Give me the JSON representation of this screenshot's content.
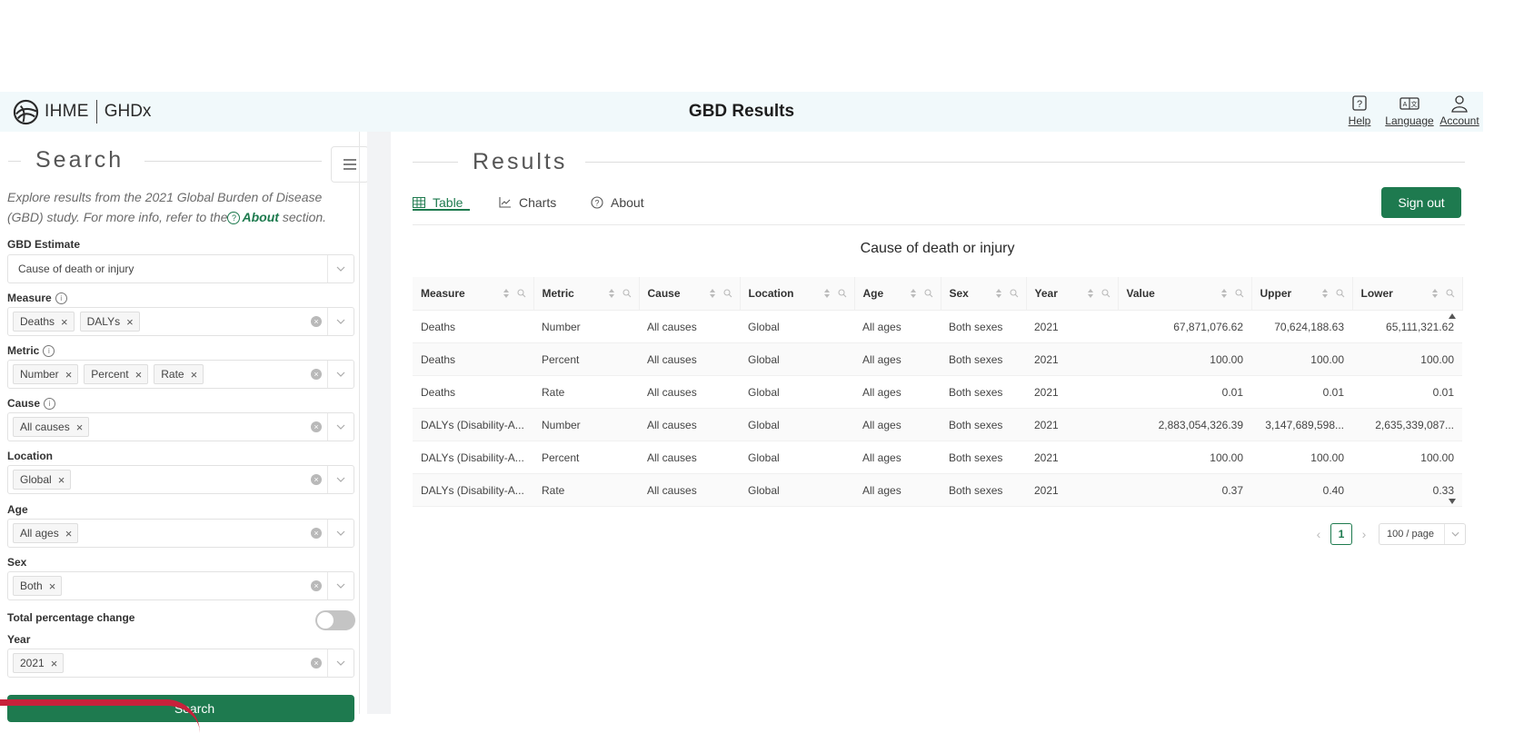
{
  "header": {
    "logo_left": "IHME",
    "logo_right": "GHDx",
    "title": "GBD Results",
    "icons": [
      {
        "label": "Help",
        "icon": "help-icon"
      },
      {
        "label": "Language",
        "icon": "language-icon"
      },
      {
        "label": "Account",
        "icon": "account-icon"
      }
    ]
  },
  "search": {
    "heading": "Search",
    "intro_text": "Explore results from the 2021 Global Burden of Disease (GBD) study. For more info, refer to the",
    "intro_link": "About",
    "intro_suffix": "section.",
    "gbd_estimate_label": "GBD Estimate",
    "gbd_estimate_value": "Cause of death or injury",
    "measure_label": "Measure",
    "measure_tags": [
      "Deaths",
      "DALYs"
    ],
    "metric_label": "Metric",
    "metric_tags": [
      "Number",
      "Percent",
      "Rate"
    ],
    "cause_label": "Cause",
    "cause_tags": [
      "All causes"
    ],
    "location_label": "Location",
    "location_tags": [
      "Global"
    ],
    "age_label": "Age",
    "age_tags": [
      "All ages"
    ],
    "sex_label": "Sex",
    "sex_tags": [
      "Both"
    ],
    "toggle_label": "Total percentage change",
    "year_label": "Year",
    "year_tags": [
      "2021"
    ],
    "search_button": "Search"
  },
  "results": {
    "heading": "Results",
    "tabs": [
      {
        "label": "Table",
        "icon": "table-icon"
      },
      {
        "label": "Charts",
        "icon": "chart-icon"
      },
      {
        "label": "About",
        "icon": "question-icon"
      }
    ],
    "sign_out": "Sign out",
    "table_title": "Cause of death or injury",
    "columns": [
      "Measure",
      "Metric",
      "Cause",
      "Location",
      "Age",
      "Sex",
      "Year",
      "Value",
      "Upper",
      "Lower"
    ],
    "rows": [
      [
        "Deaths",
        "Number",
        "All causes",
        "Global",
        "All ages",
        "Both sexes",
        "2021",
        "67,871,076.62",
        "70,624,188.63",
        "65,111,321.62"
      ],
      [
        "Deaths",
        "Percent",
        "All causes",
        "Global",
        "All ages",
        "Both sexes",
        "2021",
        "100.00",
        "100.00",
        "100.00"
      ],
      [
        "Deaths",
        "Rate",
        "All causes",
        "Global",
        "All ages",
        "Both sexes",
        "2021",
        "0.01",
        "0.01",
        "0.01"
      ],
      [
        "DALYs (Disability-A...",
        "Number",
        "All causes",
        "Global",
        "All ages",
        "Both sexes",
        "2021",
        "2,883,054,326.39",
        "3,147,689,598...",
        "2,635,339,087..."
      ],
      [
        "DALYs (Disability-A...",
        "Percent",
        "All causes",
        "Global",
        "All ages",
        "Both sexes",
        "2021",
        "100.00",
        "100.00",
        "100.00"
      ],
      [
        "DALYs (Disability-A...",
        "Rate",
        "All causes",
        "Global",
        "All ages",
        "Both sexes",
        "2021",
        "0.37",
        "0.40",
        "0.33"
      ]
    ],
    "pagination": {
      "current_page": "1",
      "page_size": "100 / page"
    }
  },
  "colors": {
    "accent": "#1e7a4f",
    "header_bg": "#f1f9fb",
    "annotation": "#c8213b"
  }
}
